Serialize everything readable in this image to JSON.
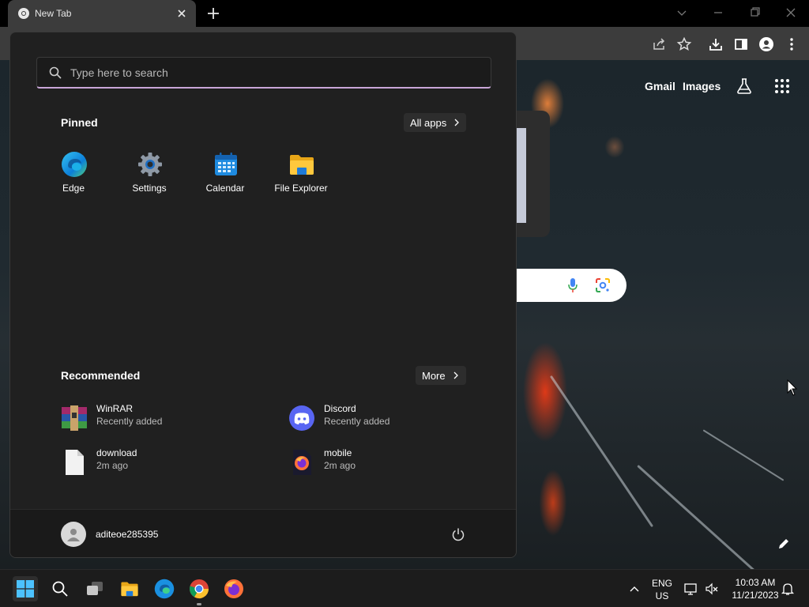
{
  "browser": {
    "tab_title": "New Tab",
    "toolbar_icons": [
      "share-icon",
      "star-icon",
      "download-icon",
      "side-panel-icon",
      "profile-icon",
      "more-icon"
    ]
  },
  "google": {
    "gmail": "Gmail",
    "images": "Images"
  },
  "start_menu": {
    "search_placeholder": "Type here to search",
    "pinned_title": "Pinned",
    "all_apps": "All apps",
    "pinned": [
      {
        "label": "Edge",
        "icon": "edge-icon"
      },
      {
        "label": "Settings",
        "icon": "settings-icon"
      },
      {
        "label": "Calendar",
        "icon": "calendar-icon"
      },
      {
        "label": "File Explorer",
        "icon": "file-explorer-icon"
      }
    ],
    "recommended_title": "Recommended",
    "more": "More",
    "recommended": [
      {
        "name": "WinRAR",
        "sub": "Recently added",
        "icon": "winrar-icon"
      },
      {
        "name": "Discord",
        "sub": "Recently added",
        "icon": "discord-icon"
      },
      {
        "name": "download",
        "sub": "2m ago",
        "icon": "file-icon"
      },
      {
        "name": "mobile",
        "sub": "2m ago",
        "icon": "firefox-file-icon"
      }
    ],
    "user_name": "aditeoe285395"
  },
  "taskbar": {
    "language": "ENG",
    "region": "US",
    "time": "10:03 AM",
    "date": "11/21/2023"
  },
  "colors": {
    "accent": "#c9a6d8",
    "start_bg": "#202020",
    "chrome_bg": "#3c3c3c"
  }
}
